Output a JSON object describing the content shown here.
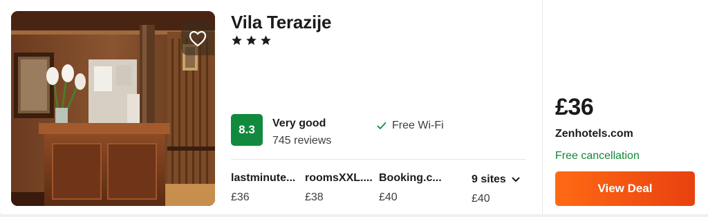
{
  "hotel": {
    "name": "Vila Terazije",
    "star_count": 3,
    "score": "8.3",
    "rating_label": "Very good",
    "reviews": "745 reviews",
    "amenity": "Free Wi-Fi",
    "favorite_icon": "heart-outline-icon"
  },
  "sites": [
    {
      "name": "lastminute...",
      "price": "£36"
    },
    {
      "name": "roomsXXL....",
      "price": "£38"
    },
    {
      "name": "Booking.c...",
      "price": "£40"
    }
  ],
  "more_sites": {
    "label": "9 sites",
    "price": "£40",
    "icon": "chevron-down-icon"
  },
  "deal": {
    "price": "£36",
    "provider": "Zenhotels.com",
    "cancellation": "Free cancellation",
    "button_label": "View Deal"
  },
  "colors": {
    "score_badge": "#128a3e",
    "cancellation_text": "#12873a",
    "button_start": "#ff6a14",
    "button_end": "#e8410f"
  }
}
